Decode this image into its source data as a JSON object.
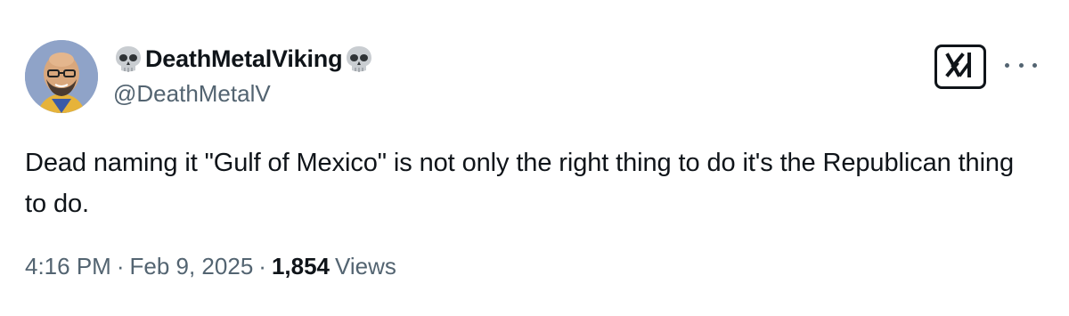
{
  "user": {
    "display_name": "DeathMetalViking",
    "handle": "@DeathMetalV",
    "name_emoji": "skull"
  },
  "tweet": {
    "text": "Dead naming it \"Gulf of Mexico\" is not only the right thing to do it's the Republican thing to do."
  },
  "meta": {
    "time": "4:16 PM",
    "separator": "·",
    "date": "Feb 9, 2025",
    "views_count": "1,854",
    "views_label": "Views"
  },
  "actions": {
    "grok_icon": "grok-icon",
    "more_icon": "more-options-icon"
  },
  "colors": {
    "primary_text": "#0f1419",
    "secondary_text": "#536471",
    "background": "#ffffff"
  }
}
